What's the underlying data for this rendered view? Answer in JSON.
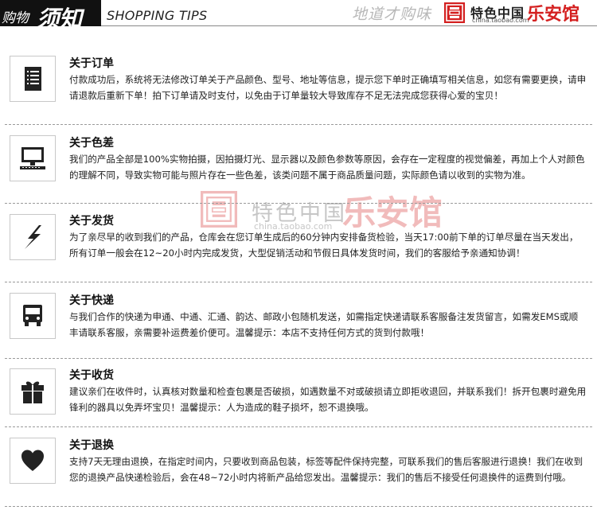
{
  "header": {
    "title_small": "购物",
    "title_big": "须知",
    "title_en": "SHOPPING TIPS",
    "slogan": "地道才购味",
    "brand_name": "特色中国",
    "brand_url": "china.taobao.com",
    "shop_mark": "乐安馆"
  },
  "watermark": {
    "brand_name": "特色中国",
    "brand_url": "china.taobao.com",
    "shop_mark": "乐安馆"
  },
  "colors": {
    "accent_red": "#d42020",
    "icon_dark": "#222222",
    "divider": "#9a9a9a"
  },
  "sections": [
    {
      "icon": "document-list-icon",
      "title": "关于订单",
      "body": "付款成功后，系统将无法修改订单关于产品颜色、型号、地址等信息，提示您下单时正确填写相关信息，如您有需要更换，请申请退款后重新下单！拍下订单请及时支付，以免由于订单量较大导致库存不足无法完成您获得心爱的宝贝！"
    },
    {
      "icon": "computer-monitor-icon",
      "title": "关于色差",
      "body": "我们的产品全部是100%实物拍摄，因拍摄灯光、显示器以及颜色参数等原因，会存在一定程度的视觉偏差，再加上个人对颜色的理解不同，导致实物可能与照片存在一些色差，该类问题不属于商品质量问题，实际颜色请以收到的实物为准。"
    },
    {
      "icon": "lightning-icon",
      "title": "关于发货",
      "body": "为了亲尽早的收到我们的产品，仓库会在您订单生成后的60分钟内安排备货检验，当天17:00前下单的订单尽量在当天发出，所有订单一般会在12~20小时内完成发货，大型促销活动和节假日具体发货时间，我们的客服给予亲通知协调！"
    },
    {
      "icon": "delivery-truck-icon",
      "title": "关于快递",
      "body": "与我们合作的快递为申通、中通、汇通、韵达、邮政小包随机发送，如需指定快递请联系客服备注发货留言，如需发EMS或顺丰请联系客服，亲需要补运费差价便可。温馨提示：本店不支持任何方式的货到付款哦！"
    },
    {
      "icon": "gift-box-icon",
      "title": "关于收货",
      "body": "建议亲们在收件时，认真核对数量和检查包裹是否破损，如遇数量不对或破损请立即拒收退回，并联系我们！拆开包裹时避免用锋利的器具以免弄坏宝贝！温馨提示：人为造成的鞋子损坏，恕不退换哦。"
    },
    {
      "icon": "heart-icon",
      "title": "关于退换",
      "body": "支持7天无理由退换，在指定时间内，只要收到商品包装，标签等配件保持完整，可联系我们的售后客服进行退换！我们在收到您的退换产品快递检验后，会在48~72小时内将新产品给您发出。温馨提示：我们的售后不接受任何退换件的运费到付哦。"
    }
  ]
}
